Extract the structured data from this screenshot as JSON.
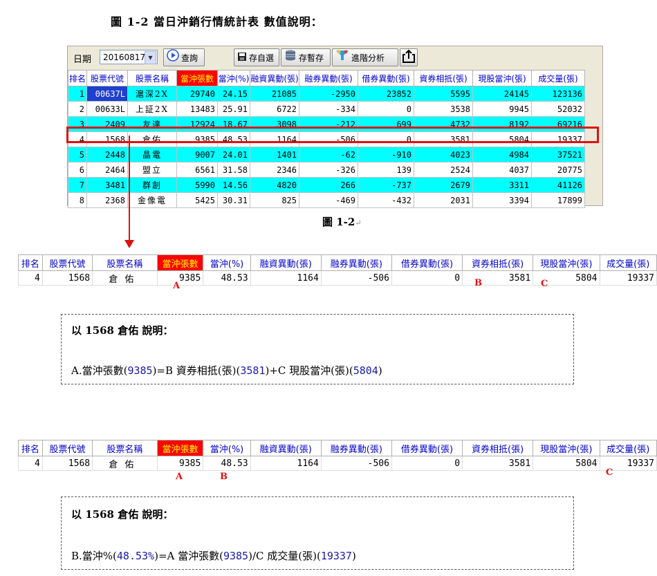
{
  "title": "圖 1-2 當日沖銷行情統計表 數值說明：",
  "caption": "圖 1-2",
  "toolbar": {
    "date_label": "日期",
    "date_value": "20160817",
    "query": "查詢",
    "save": "存自選",
    "temp": "存暫存",
    "advanced": "進階分析"
  },
  "columns": [
    "排名",
    "股票代號",
    "股票名稱",
    "當沖張數",
    "當沖(%)",
    "融資異動(張)",
    "融券異動(張)",
    "借券異動(張)",
    "資券相抵(張)",
    "現股當沖(張)",
    "成交量(張)"
  ],
  "rows": [
    [
      "1",
      "00637L",
      "滬深2X",
      "29740",
      "24.15",
      "21085",
      "-2950",
      "23852",
      "5595",
      "24145",
      "123136"
    ],
    [
      "2",
      "00633L",
      "上証2X",
      "13483",
      "25.91",
      "6722",
      "-334",
      "0",
      "3538",
      "9945",
      "52032"
    ],
    [
      "3",
      "2409",
      "友達",
      "12924",
      "18.67",
      "3098",
      "-212",
      "699",
      "4732",
      "8192",
      "69216"
    ],
    [
      "4",
      "1568",
      "倉佑",
      "9385",
      "48.53",
      "1164",
      "-506",
      "0",
      "3581",
      "5804",
      "19337"
    ],
    [
      "5",
      "2448",
      "晶電",
      "9007",
      "24.01",
      "1401",
      "-62",
      "-910",
      "4023",
      "4984",
      "37521"
    ],
    [
      "6",
      "2464",
      "盟立",
      "6561",
      "31.58",
      "2346",
      "-326",
      "139",
      "2524",
      "4037",
      "20775"
    ],
    [
      "7",
      "3481",
      "群創",
      "5990",
      "14.56",
      "4820",
      "266",
      "-737",
      "2679",
      "3311",
      "41126"
    ],
    [
      "8",
      "2368",
      "金像電",
      "5425",
      "30.31",
      "825",
      "-469",
      "-432",
      "2031",
      "3394",
      "17899"
    ]
  ],
  "excerpt": {
    "row": [
      "4",
      "1568",
      "倉佑",
      "9385",
      "48.53",
      "1164",
      "-506",
      "0",
      "3581",
      "5804",
      "19337"
    ],
    "labels": {
      "a": "A",
      "b": "B",
      "c": "C"
    }
  },
  "note1": {
    "title": "以 1568 倉佑 說明：",
    "lineA": "A.當沖張數(",
    "v1": "9385",
    "mid1": ")=B 資券相抵(張)(",
    "v2": "3581",
    "mid2": ")+C 現股當沖(張)(",
    "v3": "5804",
    "end": ")"
  },
  "note2": {
    "title": "以 1568 倉佑 說明：",
    "lineA": "B.當沖%(",
    "v1": "48.53%",
    "mid1": ")=A 當沖張數(",
    "v2": "9385",
    "mid2": ")/C 成交量(張)(",
    "v3": "19337",
    "end": ")"
  }
}
